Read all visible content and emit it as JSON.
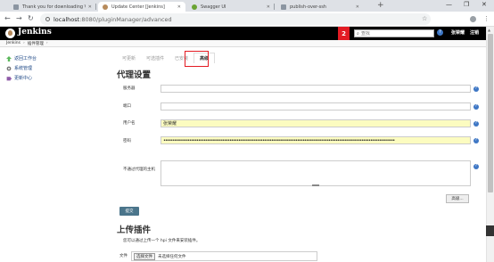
{
  "browser": {
    "tabs": [
      {
        "title": "Thank you for downloading Vi",
        "icon_color": "#8b95a1",
        "active": false
      },
      {
        "title": "Update Center [Jenkins]",
        "icon_color": "#b78b5c",
        "active": true
      },
      {
        "title": "Swagger UI",
        "icon_color": "#6aa332",
        "active": false
      },
      {
        "title": "publish-over-ssh",
        "icon_color": "#8b95a1",
        "active": false
      }
    ],
    "new_tab": "+",
    "win_min": "—",
    "win_max": "❐",
    "win_close": "✕",
    "back": "←",
    "forward": "→",
    "reload": "↻",
    "url_host": "localhost",
    "url_path": ":8080/pluginManager/advanced",
    "star": "☆",
    "menu": "⋮"
  },
  "header": {
    "title": "Jenkins",
    "badge": "2",
    "search_placeholder": "查找",
    "search_icon": "search-icon",
    "help": "?",
    "user": "张荣耀",
    "logout": "注销",
    "bg": "#000000",
    "badge_color": "#e31b23"
  },
  "breadcrumb": {
    "root": "Jenkins",
    "sep": "›",
    "page": "插件管理",
    "sep2": "›"
  },
  "sidebar": [
    {
      "label": "返回工作台",
      "icon": "up-arrow-icon",
      "color": "#5cb85c"
    },
    {
      "label": "系统管理",
      "icon": "gear-icon",
      "color": "#666666"
    },
    {
      "label": "更新中心",
      "icon": "puzzle-icon",
      "color": "#8e5aa8"
    }
  ],
  "plugin_tabs": [
    "可更新",
    "可选插件",
    "已安装",
    "高级"
  ],
  "proxy": {
    "title": "代理设置",
    "server_label": "服务器",
    "server_value": "",
    "port_label": "端口",
    "port_value": "",
    "user_label": "用户名",
    "user_value": "张荣耀",
    "password_label": "密码",
    "password_value": "•••••••••••••••••••••••••••••••••••••••••••••••••••••••••••••••••••••••••••••••••••••••••••••••••••••••••••••••••••••••••••••••••••••",
    "noproxy_label": "不通过代理的主机",
    "noproxy_value": "",
    "advanced_button": "高级...",
    "submit_button": "提交",
    "help": "?"
  },
  "upload": {
    "title": "上传插件",
    "description": "您可以通过上传一个 hpi 文件来安装插件。",
    "file_label": "文件",
    "choose_button": "选择文件",
    "no_file": "未选择任何文件"
  }
}
